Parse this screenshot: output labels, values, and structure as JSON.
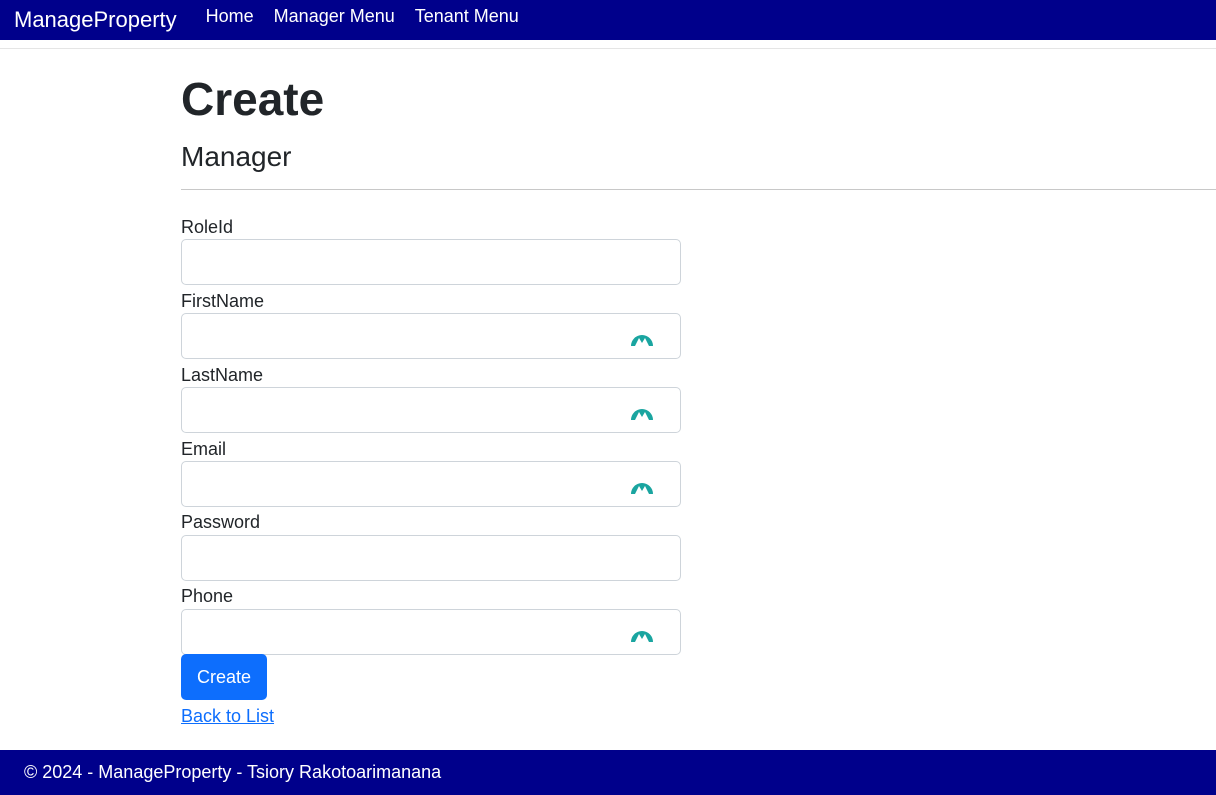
{
  "nav": {
    "brand": "ManageProperty",
    "links": [
      "Home",
      "Manager Menu",
      "Tenant Menu"
    ]
  },
  "page": {
    "title": "Create",
    "subtitle": "Manager"
  },
  "form": {
    "fields": [
      {
        "label": "RoleId",
        "value": "",
        "autofill_icon": false
      },
      {
        "label": "FirstName",
        "value": "",
        "autofill_icon": true
      },
      {
        "label": "LastName",
        "value": "",
        "autofill_icon": true
      },
      {
        "label": "Email",
        "value": "",
        "autofill_icon": true
      },
      {
        "label": "Password",
        "value": "",
        "autofill_icon": false
      },
      {
        "label": "Phone",
        "value": "",
        "autofill_icon": true
      }
    ],
    "submit_label": "Create",
    "back_label": "Back to List"
  },
  "footer": {
    "text": "© 2024 - ManageProperty - Tsiory Rakotoarimanana"
  },
  "colors": {
    "nav_bg": "#00008b",
    "primary": "#0d6efd",
    "autofill_icon": "#1aa5a0"
  }
}
